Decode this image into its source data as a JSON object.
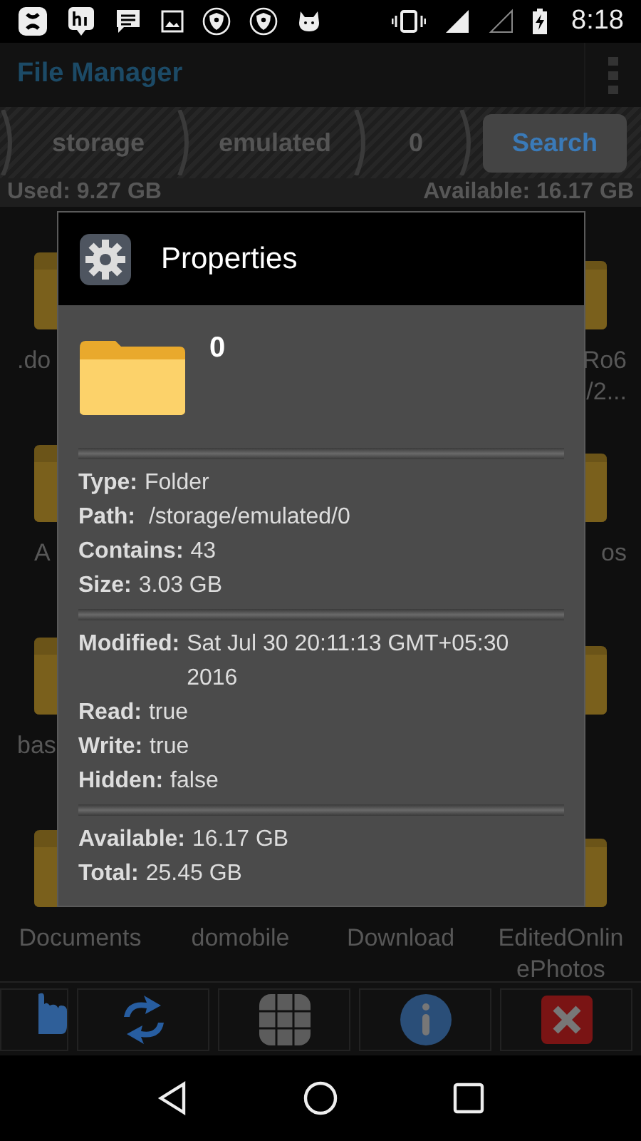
{
  "status_bar": {
    "time": "8:18"
  },
  "app_bar": {
    "title": "File Manager"
  },
  "breadcrumbs": [
    {
      "label": "storage"
    },
    {
      "label": "emulated"
    },
    {
      "label": "0"
    }
  ],
  "search_button": {
    "label": "Search"
  },
  "storage_bar": {
    "used": "Used: 9.27 GB",
    "available": "Available: 16.17 GB"
  },
  "folder_rows": [
    {
      "cells": [
        {
          "lines": [
            ".do"
          ]
        },
        {},
        {},
        {
          "lines": [
            "Ro6",
            "/2..."
          ]
        }
      ]
    },
    {
      "cells": [
        {
          "lines": [
            "A"
          ]
        },
        {},
        {},
        {
          "lines": [
            "os"
          ]
        }
      ]
    },
    {
      "cells": [
        {
          "lines": [
            "bas"
          ]
        },
        {},
        {},
        {}
      ]
    },
    {
      "cells": [
        {
          "lines": [
            "Documents"
          ]
        },
        {
          "lines": [
            "domobile"
          ]
        },
        {
          "lines": [
            "Download"
          ]
        },
        {
          "lines": [
            "EditedOnlin",
            "ePhotos"
          ]
        }
      ]
    }
  ],
  "dialog": {
    "title": "Properties",
    "name": "0",
    "sections": [
      [
        {
          "key": "Type:",
          "value": "Folder"
        },
        {
          "key": "Path:",
          "value": " /storage/emulated/0"
        },
        {
          "key": "Contains:",
          "value": "43"
        },
        {
          "key": "Size:",
          "value": "3.03 GB"
        }
      ],
      [
        {
          "key": "Modified:",
          "value": "Sat Jul 30 20:11:13 GMT+05:30 2016"
        },
        {
          "key": "Read:",
          "value": "true"
        },
        {
          "key": "Write:",
          "value": "true"
        },
        {
          "key": "Hidden:",
          "value": "false"
        }
      ],
      [
        {
          "key": "Available:",
          "value": "16.17 GB"
        },
        {
          "key": "Total:",
          "value": "25.45 GB"
        }
      ]
    ]
  },
  "toolbar": [
    {
      "kind": "hand"
    },
    {
      "kind": "refresh"
    },
    {
      "kind": "grid"
    },
    {
      "kind": "info"
    },
    {
      "kind": "close"
    }
  ]
}
